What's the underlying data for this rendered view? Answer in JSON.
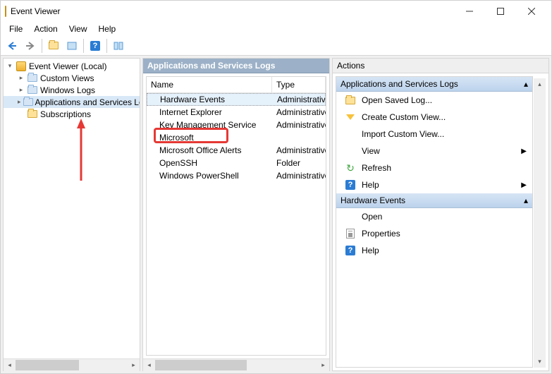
{
  "window": {
    "title": "Event Viewer"
  },
  "menu": {
    "file": "File",
    "action": "Action",
    "view": "View",
    "help": "Help"
  },
  "tree": {
    "root": "Event Viewer (Local)",
    "items": [
      {
        "label": "Custom Views"
      },
      {
        "label": "Windows Logs"
      },
      {
        "label": "Applications and Services Logs",
        "selected": true
      },
      {
        "label": "Subscriptions"
      }
    ]
  },
  "list": {
    "title": "Applications and Services Logs",
    "cols": {
      "name": "Name",
      "type": "Type"
    },
    "rows": [
      {
        "name": "Hardware Events",
        "type": "Administrative",
        "selected": true
      },
      {
        "name": "Internet Explorer",
        "type": "Administrative"
      },
      {
        "name": "Key Management Service",
        "type": "Administrative"
      },
      {
        "name": "Microsoft",
        "type": "",
        "highlighted": true
      },
      {
        "name": "Microsoft Office Alerts",
        "type": "Administrative"
      },
      {
        "name": "OpenSSH",
        "type": "Folder"
      },
      {
        "name": "Windows PowerShell",
        "type": "Administrative"
      }
    ]
  },
  "actions": {
    "title": "Actions",
    "section1": {
      "title": "Applications and Services Logs",
      "items": [
        {
          "label": "Open Saved Log...",
          "icon": "folder"
        },
        {
          "label": "Create Custom View...",
          "icon": "filter"
        },
        {
          "label": "Import Custom View...",
          "icon": ""
        },
        {
          "label": "View",
          "icon": "",
          "submenu": true
        },
        {
          "label": "Refresh",
          "icon": "refresh"
        },
        {
          "label": "Help",
          "icon": "help",
          "submenu": true
        }
      ]
    },
    "section2": {
      "title": "Hardware Events",
      "items": [
        {
          "label": "Open",
          "icon": ""
        },
        {
          "label": "Properties",
          "icon": "prop"
        },
        {
          "label": "Help",
          "icon": "help"
        }
      ]
    }
  }
}
